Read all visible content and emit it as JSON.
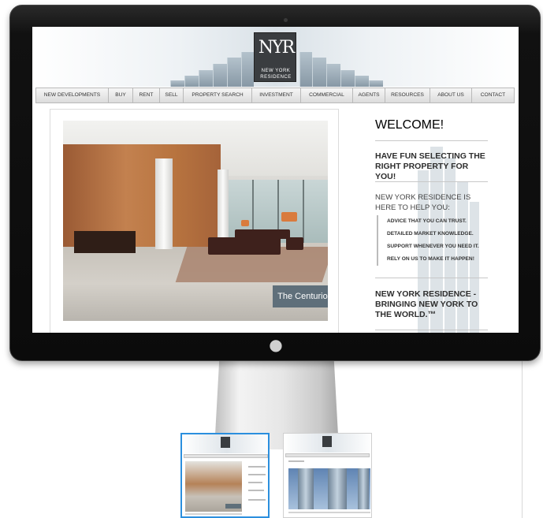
{
  "site": {
    "logo": {
      "monogram": "NYR",
      "line1": "NEW YORK",
      "line2": "RESIDENCE"
    },
    "nav": [
      {
        "label": "NEW DEVELOPMENTS"
      },
      {
        "label": "BUY"
      },
      {
        "label": "RENT"
      },
      {
        "label": "SELL"
      },
      {
        "label": "PROPERTY SEARCH"
      },
      {
        "label": "INVESTMENT"
      },
      {
        "label": "COMMERCIAL"
      },
      {
        "label": "AGENTS"
      },
      {
        "label": "RESOURCES"
      },
      {
        "label": "ABOUT US"
      },
      {
        "label": "CONTACT"
      }
    ],
    "slideshow": {
      "caption": "The Centurion"
    },
    "sidebar": {
      "welcome": "WELCOME!",
      "fun": "HAVE FUN SELECTING THE RIGHT PROPERTY FOR YOU!",
      "here_to_help": "NEW YORK RESIDENCE IS HERE TO HELP YOU:",
      "points": [
        "ADVICE THAT YOU CAN TRUST.",
        "DETAILED MARKET KNOWLEDGE.",
        "SUPPORT WHENEVER YOU NEED IT.",
        "RELY ON US TO MAKE IT HAPPEN!"
      ],
      "slogan": "NEW YORK RESIDENCE - BRINGING NEW YORK TO THE WORLD.™"
    }
  },
  "device": {
    "bezel_icon": "apple-logo-icon"
  },
  "colors": {
    "caption_bg": "#5f6f7a",
    "selected_thumb_border": "#2b8fde",
    "bezel": "#0b0b0b"
  }
}
